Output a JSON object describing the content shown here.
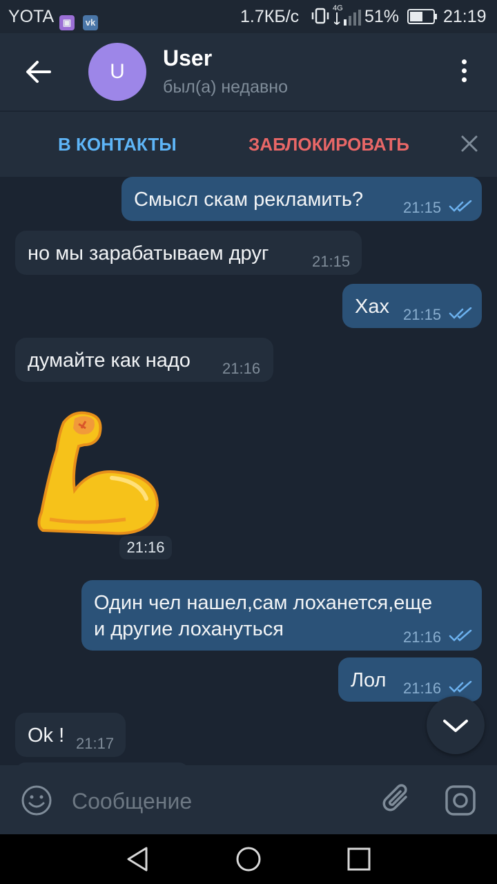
{
  "status_bar": {
    "carrier": "YOTA",
    "vk_icon_text": "vk",
    "speed": "1.7КБ/с",
    "network": "4G",
    "battery": "51%",
    "time": "21:19"
  },
  "header": {
    "avatar_letter": "U",
    "title": "User",
    "subtitle": "был(а) недавно"
  },
  "action_bar": {
    "add_contact": "В КОНТАКТЫ",
    "block": "ЗАБЛОКИРОВАТЬ"
  },
  "messages": [
    {
      "dir": "out",
      "text": "Смысл скам рекламить?",
      "time": "21:15"
    },
    {
      "dir": "in",
      "text": "но мы зарабатываем друг",
      "time": "21:15"
    },
    {
      "dir": "out",
      "text": "Хах",
      "time": "21:15"
    },
    {
      "dir": "in",
      "text": "думайте как надо",
      "time": "21:16"
    },
    {
      "dir": "in",
      "sticker": "flexed-biceps-sticker",
      "time": "21:16"
    },
    {
      "dir": "out",
      "text": "Один чел нашел,сам лоханется,еще\nи другие лохануться",
      "time": "21:16"
    },
    {
      "dir": "out",
      "text": "Лол",
      "time": "21:16"
    },
    {
      "dir": "in",
      "text": "Ok !",
      "time": "21:17"
    }
  ],
  "composer": {
    "placeholder": "Сообщение"
  },
  "colors": {
    "background": "#1b2431",
    "header": "#232e3c",
    "outgoing_bubble": "#2b5278",
    "incoming_bubble": "#232e3c",
    "accent_blue": "#5eb5f7",
    "danger_red": "#e86767",
    "avatar": "#9d86e8"
  },
  "icons": [
    "back-arrow-icon",
    "more-vertical-icon",
    "close-icon",
    "double-check-icon",
    "chevron-down-icon",
    "emoji-icon",
    "paperclip-icon",
    "camera-icon",
    "nav-back-icon",
    "nav-home-icon",
    "nav-recents-icon"
  ]
}
